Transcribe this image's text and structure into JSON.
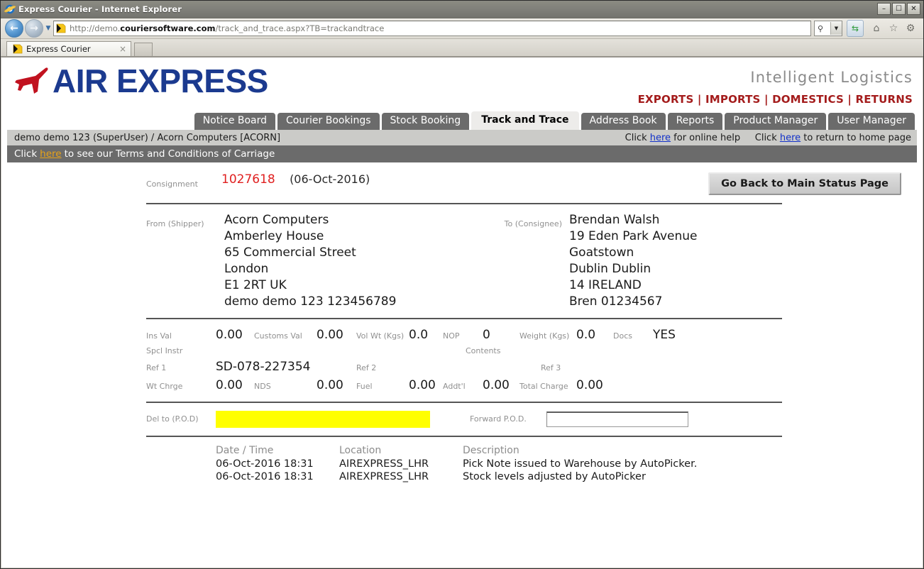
{
  "browser": {
    "title": "Express Courier - Internet Explorer",
    "title_icon": "internet-explorer-icon",
    "url_scheme": "http://demo.",
    "url_host": "couriersoftware.com",
    "url_path": "/track_and_trace.aspx?TB=trackandtrace",
    "url_full": "http://demo.couriersoftware.com/track_and_trace.aspx?TB=trackandtrace",
    "tab_label": "Express Courier",
    "tab_close": "×",
    "minimize": "–",
    "maximize": "☐",
    "close": "✕",
    "back_glyph": "←",
    "forward_glyph": "→",
    "history_caret": "▼",
    "search_glyph": "⚲",
    "search_caret": "▼",
    "refresh_glyph": "⇆",
    "home_glyph": "⌂",
    "favorites_glyph": "☆",
    "settings_glyph": "⚙"
  },
  "site": {
    "logo_text": "AIR EXPRESS",
    "logo_icon": "airplane-icon",
    "tagline": "Intelligent Logistics",
    "service_links": "EXPORTS | IMPORTS | DOMESTICS | RETURNS",
    "brand_blue": "#1b3a8f",
    "brand_red": "#a41c1c",
    "plane_red": "#c1121f"
  },
  "nav": {
    "tabs": [
      {
        "label": "Notice Board",
        "active": false
      },
      {
        "label": "Courier Bookings",
        "active": false
      },
      {
        "label": "Stock Booking",
        "active": false
      },
      {
        "label": "Track and Trace",
        "active": true
      },
      {
        "label": "Address Book",
        "active": false
      },
      {
        "label": "Reports",
        "active": false
      },
      {
        "label": "Product Manager",
        "active": false
      },
      {
        "label": "User Manager",
        "active": false
      }
    ]
  },
  "userbar": {
    "account": "demo demo 123 (SuperUser) / Acorn Computers [ACORN]",
    "help_prefix": "Click ",
    "help_link": "here",
    "help_suffix": " for online help",
    "home_prefix": "Click ",
    "home_link": "here",
    "home_suffix": " to return to home page"
  },
  "termsbar": {
    "prefix": "Click ",
    "link": "here",
    "suffix": " to see our Terms and Conditions of Carriage"
  },
  "consignment": {
    "label": "Consignment",
    "number": "1027618",
    "date": "(06-Oct-2016)",
    "back_button": "Go Back to Main Status Page"
  },
  "shipper": {
    "label": "From (Shipper)",
    "lines": [
      "Acorn Computers",
      "Amberley House",
      "65 Commercial Street",
      "London",
      "E1 2RT UK",
      "demo demo 123 123456789"
    ]
  },
  "consignee": {
    "label": "To (Consignee)",
    "lines": [
      "Brendan Walsh",
      "19 Eden Park Avenue",
      "Goatstown",
      "Dublin Dublin",
      "14 IRELAND",
      "Bren 01234567"
    ]
  },
  "details": {
    "ins_val_label": "Ins Val",
    "ins_val": "0.00",
    "customs_val_label": "Customs Val",
    "customs_val": "0.00",
    "vol_wt_label": "Vol Wt (Kgs)",
    "vol_wt": "0.0",
    "nop_label": "NOP",
    "nop": "0",
    "weight_label": "Weight (Kgs)",
    "weight": "0.0",
    "docs_label": "Docs",
    "docs": "YES",
    "spcl_instr_label": "Spcl Instr",
    "spcl_instr": "",
    "contents_label": "Contents",
    "contents": "",
    "ref1_label": "Ref 1",
    "ref1": "SD-078-227354",
    "ref2_label": "Ref 2",
    "ref2": "",
    "ref3_label": "Ref 3",
    "ref3": "",
    "wt_chrge_label": "Wt Chrge",
    "wt_chrge": "0.00",
    "nds_label": "NDS",
    "nds": "0.00",
    "fuel_label": "Fuel",
    "fuel": "0.00",
    "addtl_label": "Addt'l",
    "addtl": "0.00",
    "total_charge_label": "Total Charge",
    "total_charge": "0.00"
  },
  "pod": {
    "del_to_label": "Del to (P.O.D)",
    "del_to_value": "",
    "del_to_highlight": "#ffff00",
    "forward_label": "Forward P.O.D.",
    "forward_value": ""
  },
  "events": {
    "headers": [
      "Date / Time",
      "Location",
      "Description"
    ],
    "rows": [
      [
        "06-Oct-2016 18:31",
        "AIREXPRESS_LHR",
        "Pick Note issued to Warehouse by AutoPicker."
      ],
      [
        "06-Oct-2016 18:31",
        "AIREXPRESS_LHR",
        "Stock levels adjusted by AutoPicker"
      ]
    ]
  }
}
